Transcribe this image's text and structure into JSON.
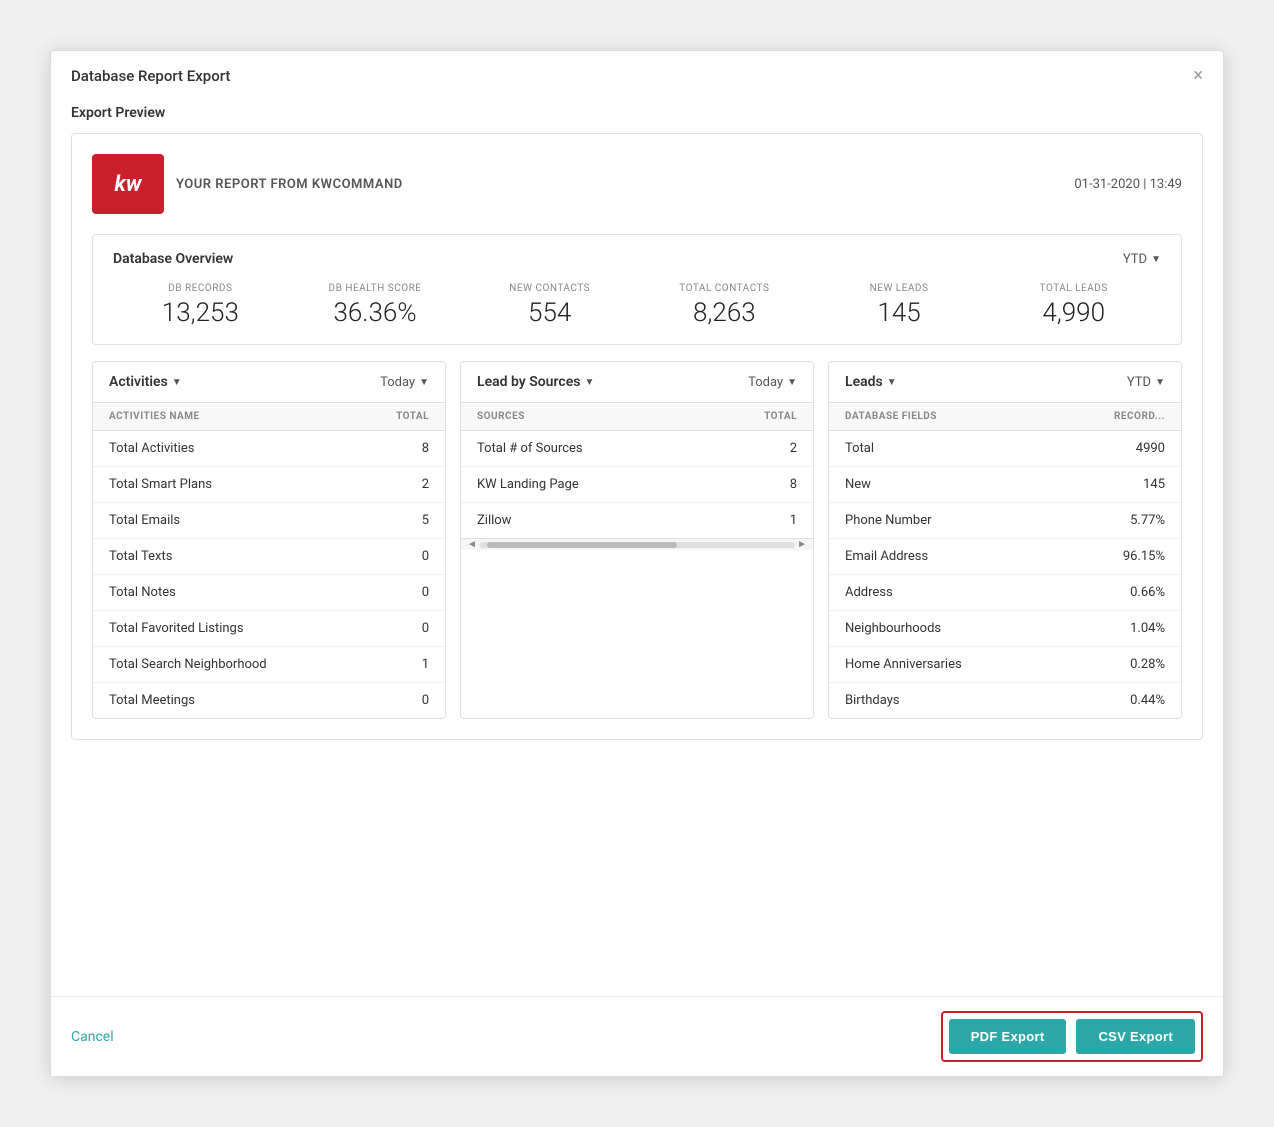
{
  "modal": {
    "title": "Database Report Export",
    "close_label": "×"
  },
  "export_preview": {
    "label": "Export Preview"
  },
  "report_header": {
    "logo_text": "kw",
    "report_from": "YOUR REPORT FROM KWCOMMAND",
    "datetime": "01-31-2020 | 13:49"
  },
  "db_overview": {
    "title": "Database Overview",
    "period": "YTD",
    "stats": [
      {
        "label": "DB RECORDS",
        "value": "13,253"
      },
      {
        "label": "DB HEALTH SCORE",
        "value": "36.36%"
      },
      {
        "label": "NEW CONTACTS",
        "value": "554"
      },
      {
        "label": "TOTAL CONTACTS",
        "value": "8,263"
      },
      {
        "label": "NEW LEADS",
        "value": "145"
      },
      {
        "label": "TOTAL LEADS",
        "value": "4,990"
      }
    ]
  },
  "panels": {
    "activities": {
      "title": "Activities",
      "period": "Today",
      "col1": "ACTIVITIES NAME",
      "col2": "TOTAL",
      "rows": [
        {
          "name": "Total Activities",
          "value": "8"
        },
        {
          "name": "Total Smart Plans",
          "value": "2"
        },
        {
          "name": "Total Emails",
          "value": "5"
        },
        {
          "name": "Total Texts",
          "value": "0"
        },
        {
          "name": "Total Notes",
          "value": "0"
        },
        {
          "name": "Total Favorited Listings",
          "value": "0"
        },
        {
          "name": "Total Search Neighborhood",
          "value": "1"
        },
        {
          "name": "Total Meetings",
          "value": "0"
        }
      ]
    },
    "lead_by_sources": {
      "title": "Lead by Sources",
      "period": "Today",
      "col1": "SOURCES",
      "col2": "TOTAL",
      "rows": [
        {
          "name": "Total # of Sources",
          "value": "2"
        },
        {
          "name": "KW Landing Page",
          "value": "8"
        },
        {
          "name": "Zillow",
          "value": "1"
        }
      ]
    },
    "leads": {
      "title": "Leads",
      "period": "YTD",
      "col1": "DATABASE FIELDS",
      "col2": "RECORD...",
      "rows": [
        {
          "name": "Total",
          "value": "4990"
        },
        {
          "name": "New",
          "value": "145"
        },
        {
          "name": "Phone Number",
          "value": "5.77%"
        },
        {
          "name": "Email Address",
          "value": "96.15%"
        },
        {
          "name": "Address",
          "value": "0.66%"
        },
        {
          "name": "Neighbourhoods",
          "value": "1.04%"
        },
        {
          "name": "Home Anniversaries",
          "value": "0.28%"
        },
        {
          "name": "Birthdays",
          "value": "0.44%"
        }
      ]
    }
  },
  "footer": {
    "cancel_label": "Cancel",
    "pdf_export_label": "PDF Export",
    "csv_export_label": "CSV Export"
  }
}
